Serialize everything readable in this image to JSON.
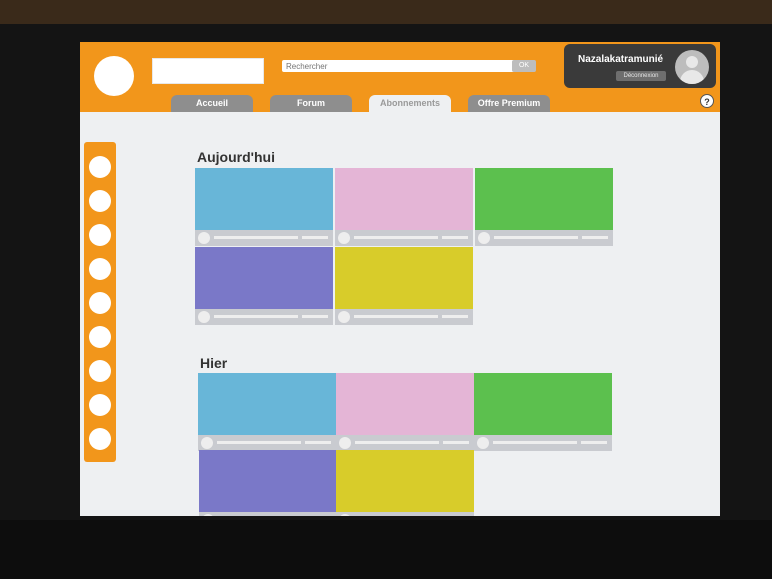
{
  "header": {
    "search_placeholder": "Rechercher",
    "search_button": "OK",
    "user_name": "Nazalakatramunié",
    "logout_label": "Déconnexion",
    "help_label": "?"
  },
  "tabs": [
    {
      "label": "Accueil"
    },
    {
      "label": "Forum"
    },
    {
      "label": "Abonnements"
    },
    {
      "label": "Offre Premium"
    }
  ],
  "sections": [
    {
      "title": "Aujourd'hui"
    },
    {
      "title": "Hier"
    }
  ],
  "colors": {
    "accent_orange": "#f2961b",
    "card_blue": "#68b6d8",
    "card_pink": "#e4b5d6",
    "card_green": "#5cc04e",
    "card_purple": "#7a78c8",
    "card_yellow": "#d8cc2a"
  }
}
